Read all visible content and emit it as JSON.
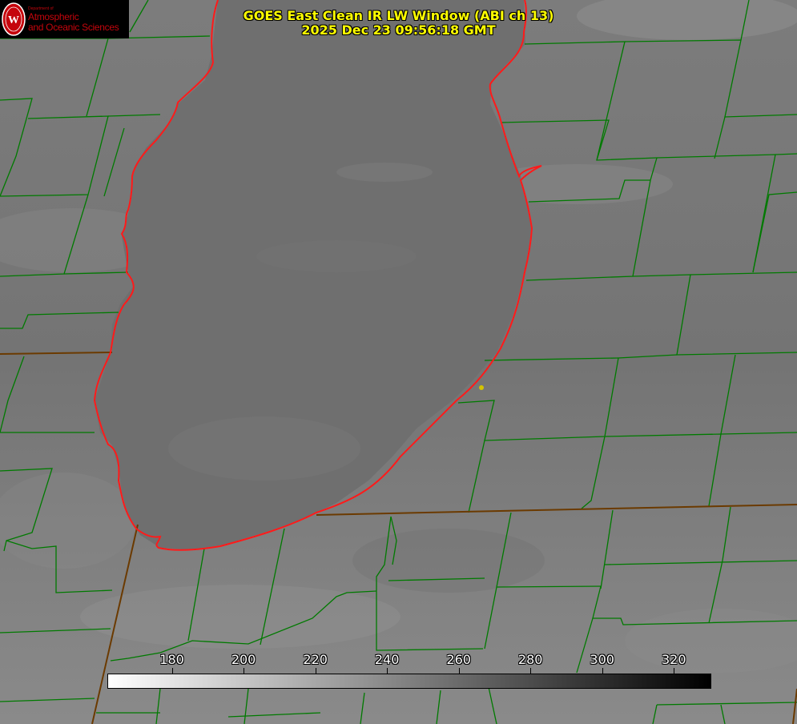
{
  "title": {
    "line1": "GOES East Clean IR LW Window (ABI ch 13)",
    "line2": "2025 Dec 23 09:56:18 GMT"
  },
  "logo": {
    "dept": "Department of",
    "line1": "Atmospheric",
    "line2": "and Oceanic Sciences"
  },
  "colorbar": {
    "min": 162,
    "max": 330,
    "ticks": [
      "180",
      "200",
      "220",
      "240",
      "260",
      "280",
      "300",
      "320"
    ],
    "gradient": [
      "#ffffff",
      "#000000"
    ]
  },
  "colors": {
    "background": "#7a7a7a",
    "lake": "#6f6f6f",
    "county_lines": "#007a00",
    "shoreline": "#ff1a1a",
    "title": "#ffff00",
    "marker": "#d4c400"
  }
}
